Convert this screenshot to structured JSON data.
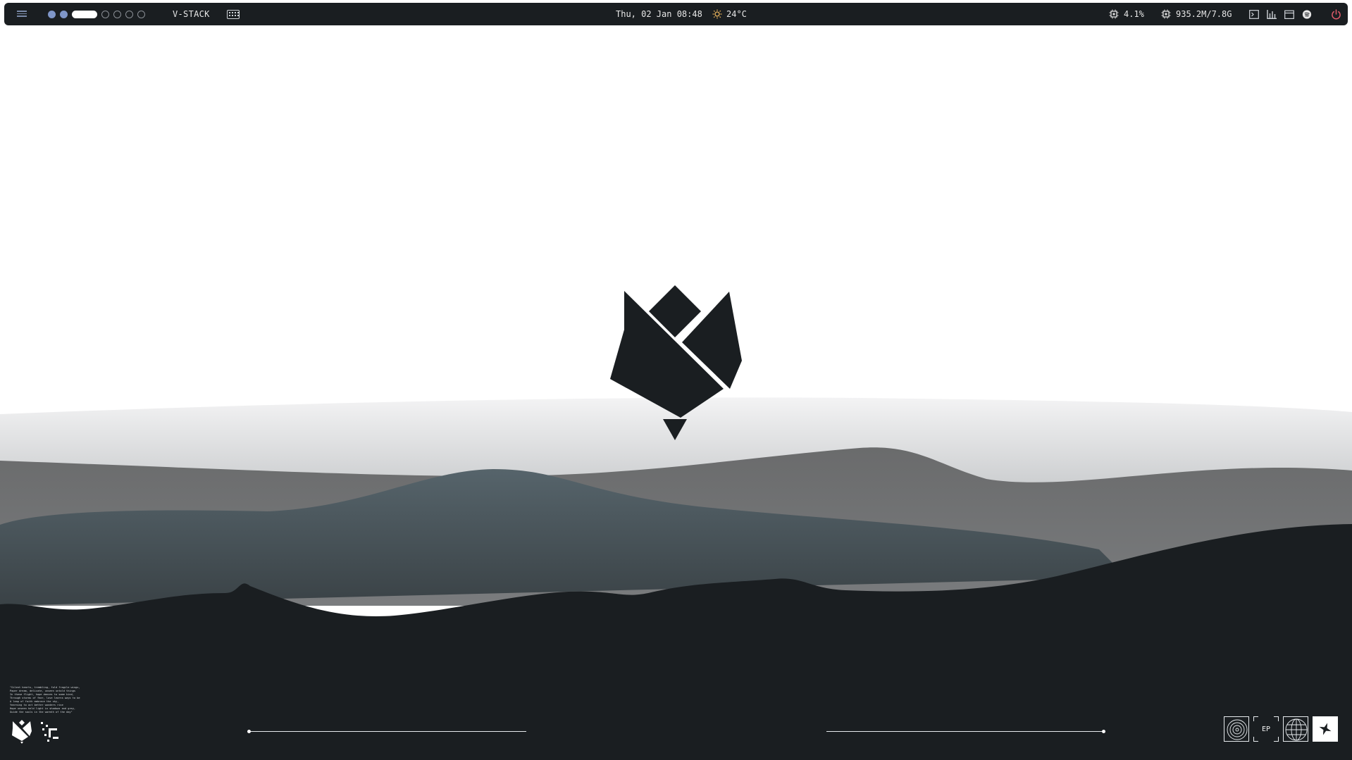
{
  "topbar": {
    "workspaces": [
      {
        "state": "filled"
      },
      {
        "state": "filled"
      },
      {
        "state": "active"
      },
      {
        "state": "empty"
      },
      {
        "state": "empty"
      },
      {
        "state": "empty"
      },
      {
        "state": "empty"
      }
    ],
    "layout_label": "V-STACK",
    "clock": "Thu, 02 Jan 08:48",
    "weather": "24°C",
    "cpu": "4.1%",
    "memory": "935.2M/7.8G",
    "tray_icons": [
      "terminal-icon",
      "chart-icon",
      "calendar-icon",
      "spotify-icon"
    ],
    "colors": {
      "bar_bg": "#1a1e21",
      "accent": "#7f96c8",
      "power": "#e05a6a",
      "weather_icon": "#e8b25a"
    }
  },
  "desktop": {
    "poem": "\"Silent hearts, trembling, fold fragile wings,\nPaper dream, delicate, unseen untold things\nIn these flight, hope dances to some kind,\nThrough storms of fear, love learns ways to be\nA leap of faith embrace the sky,\nYearning to act better wonders rise\nHope unseen held light in shadows and grey,\nGuide the souls in the warmth of the day\"",
    "dock": [
      "vinyl-icon",
      "EP",
      "globe-icon",
      "star-icon"
    ],
    "colors": {
      "sky": "#ffffff",
      "far_hills": "#6b6e70",
      "mid_hills": "#525f66",
      "front_hills": "#1a1e21"
    }
  }
}
